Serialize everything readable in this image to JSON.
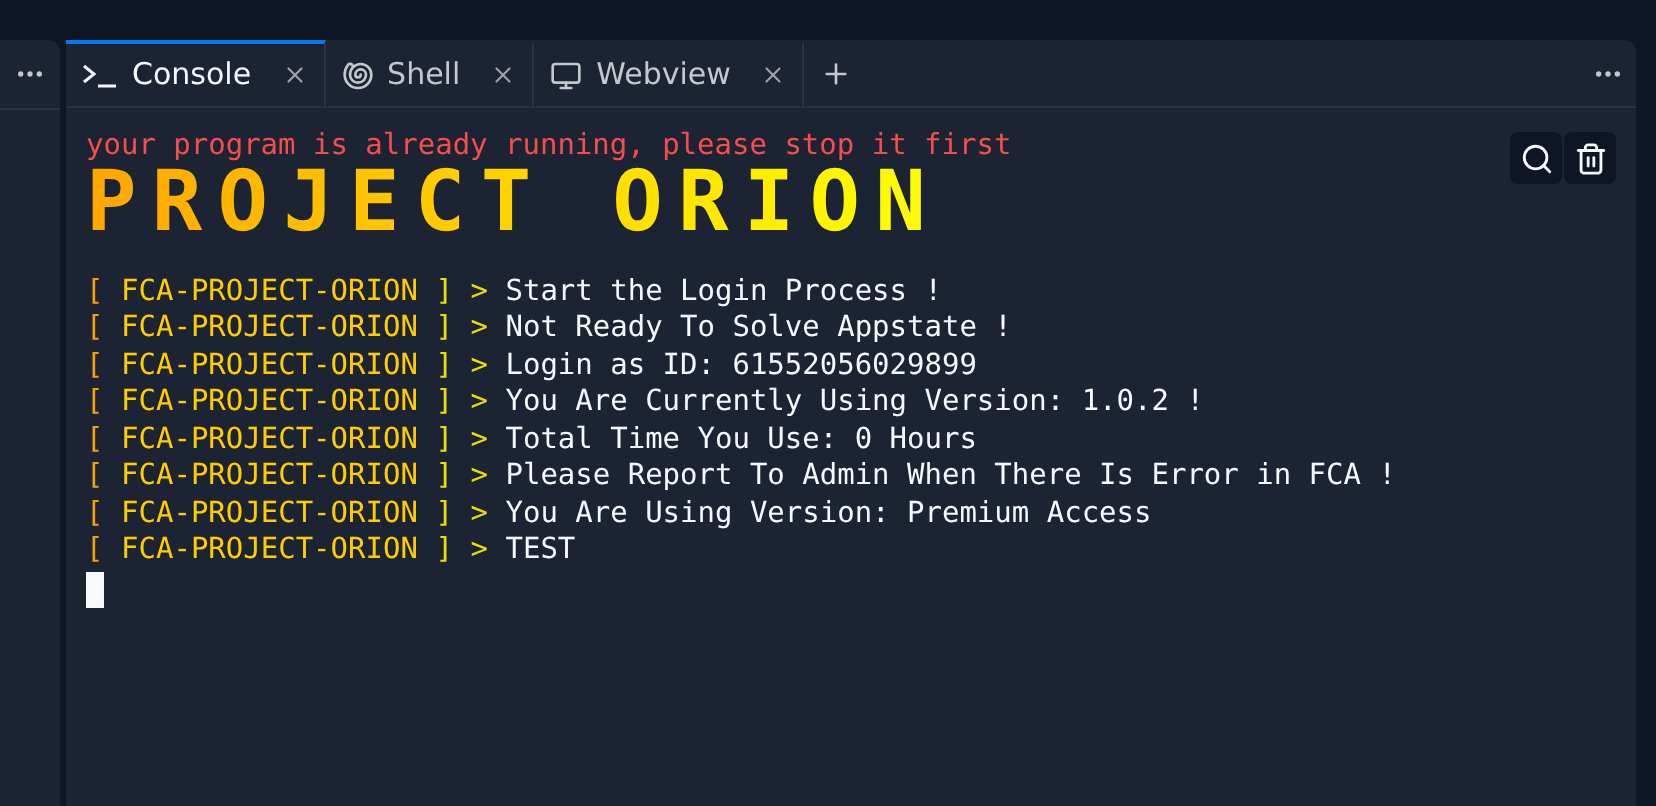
{
  "tabs": [
    {
      "label": "Console",
      "kind": "console",
      "selected": true
    },
    {
      "label": "Shell",
      "kind": "shell",
      "selected": false
    },
    {
      "label": "Webview",
      "kind": "webview",
      "selected": false
    }
  ],
  "console": {
    "error": "your program is already running, please stop it first",
    "banner": "PROJECT ORION",
    "lines": [
      {
        "open": "[",
        "source": "FCA-PROJECT-ORION",
        "close": "] >",
        "message": "Start the Login Process !"
      },
      {
        "open": "[",
        "source": "FCA-PROJECT-ORION",
        "close": "] >",
        "message": "Not Ready To Solve Appstate !"
      },
      {
        "open": "[",
        "source": "FCA-PROJECT-ORION",
        "close": "] >",
        "message": "Login as ID: 61552056029899"
      },
      {
        "open": "[",
        "source": "FCA-PROJECT-ORION",
        "close": "] >",
        "message": "You Are Currently Using Version: 1.0.2 !"
      },
      {
        "open": "[",
        "source": "FCA-PROJECT-ORION",
        "close": "] >",
        "message": "Total Time You Use: 0 Hours"
      },
      {
        "open": "[",
        "source": "FCA-PROJECT-ORION",
        "close": "] >",
        "message": "Please Report To Admin When There Is Error in FCA !"
      },
      {
        "open": "[",
        "source": "FCA-PROJECT-ORION",
        "close": "] >",
        "message": "You Are Using Version: Premium Access"
      },
      {
        "open": "[",
        "source": "FCA-PROJECT-ORION",
        "close": "] >",
        "message": "TEST"
      }
    ]
  }
}
